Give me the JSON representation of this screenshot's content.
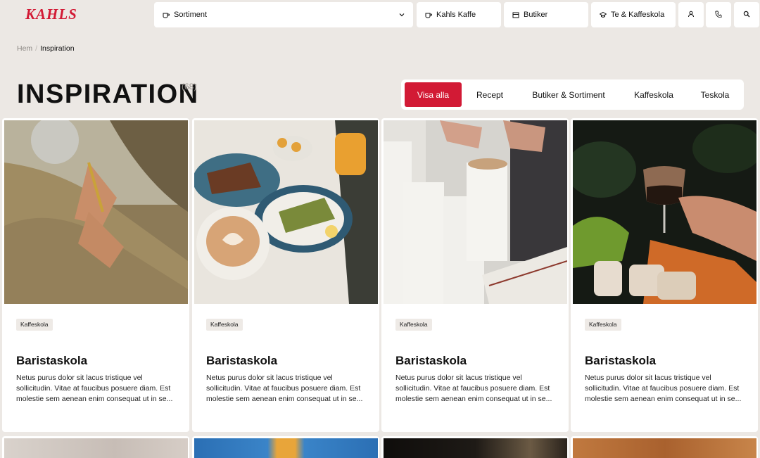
{
  "header": {
    "logo_text": "KAHLS",
    "nav": [
      {
        "label": "Sortiment",
        "icon": "mug-icon"
      },
      {
        "label": "Kahls Kaffe",
        "icon": "coffee-cup-icon"
      },
      {
        "label": "Butiker",
        "icon": "store-icon"
      },
      {
        "label": "Te & Kaffeskola",
        "icon": "graduation-cap-icon"
      }
    ],
    "icons": [
      "user-icon",
      "phone-icon",
      "search-icon"
    ]
  },
  "breadcrumb": {
    "home": "Hem",
    "separator": "/",
    "current": "Inspiration"
  },
  "page": {
    "title": "INSPIRATION",
    "count": "(68)"
  },
  "filters": [
    {
      "label": "Visa alla",
      "active": true
    },
    {
      "label": "Recept",
      "active": false
    },
    {
      "label": "Butiker & Sortiment",
      "active": false
    },
    {
      "label": "Kaffeskola",
      "active": false
    },
    {
      "label": "Teskola",
      "active": false
    }
  ],
  "cards": [
    {
      "tag": "Kaffeskola",
      "title": "Baristaskola",
      "text": "Netus purus dolor sit lacus tristique vel sollicitudin. Vitae at faucibus posuere diam. Est molestie sem aenean enim consequat ut in se..."
    },
    {
      "tag": "Kaffeskola",
      "title": "Baristaskola",
      "text": "Netus purus dolor sit lacus tristique vel sollicitudin. Vitae at faucibus posuere diam. Est molestie sem aenean enim consequat ut in se..."
    },
    {
      "tag": "Kaffeskola",
      "title": "Baristaskola",
      "text": "Netus purus dolor sit lacus tristique vel sollicitudin. Vitae at faucibus posuere diam. Est molestie sem aenean enim consequat ut in se..."
    },
    {
      "tag": "Kaffeskola",
      "title": "Baristaskola",
      "text": "Netus purus dolor sit lacus tristique vel sollicitudin. Vitae at faucibus posuere diam. Est molestie sem aenean enim consequat ut in se..."
    }
  ],
  "colors": {
    "accent": "#d21a35",
    "background": "#ece8e4"
  }
}
